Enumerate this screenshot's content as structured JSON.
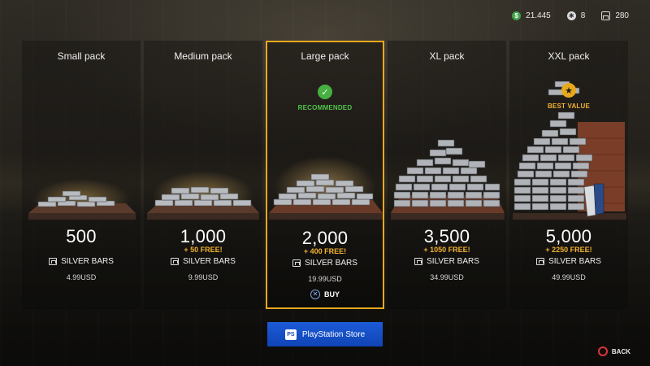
{
  "currencies": [
    {
      "icon": "money-icon",
      "value": "21.445"
    },
    {
      "icon": "chip-icon",
      "value": "8"
    },
    {
      "icon": "silver-bars-icon",
      "value": "280"
    }
  ],
  "packs": [
    {
      "name": "Small pack",
      "badge": "",
      "amount": "500",
      "bonus": "",
      "currency": "SILVER BARS",
      "price": "4.99USD"
    },
    {
      "name": "Medium pack",
      "badge": "",
      "amount": "1,000",
      "bonus": "+ 50 FREE!",
      "currency": "SILVER BARS",
      "price": "9.99USD"
    },
    {
      "name": "Large pack",
      "badge": "RECOMMENDED",
      "amount": "2,000",
      "bonus": "+ 400 FREE!",
      "currency": "SILVER BARS",
      "price": "19.99USD",
      "action": "BUY"
    },
    {
      "name": "XL pack",
      "badge": "",
      "amount": "3,500",
      "bonus": "+ 1050 FREE!",
      "currency": "SILVER BARS",
      "price": "34.99USD"
    },
    {
      "name": "XXL pack",
      "badge": "BEST VALUE",
      "amount": "5,000",
      "bonus": "+ 2250 FREE!",
      "currency": "SILVER BARS",
      "price": "49.99USD"
    }
  ],
  "store": {
    "label": "PlayStation Store"
  },
  "footer": {
    "back_label": "BACK"
  },
  "colors": {
    "accent": "#e8a81e",
    "bonus": "#f2b230",
    "recommended": "#52c44a",
    "store_blue": "#0f44b6"
  }
}
